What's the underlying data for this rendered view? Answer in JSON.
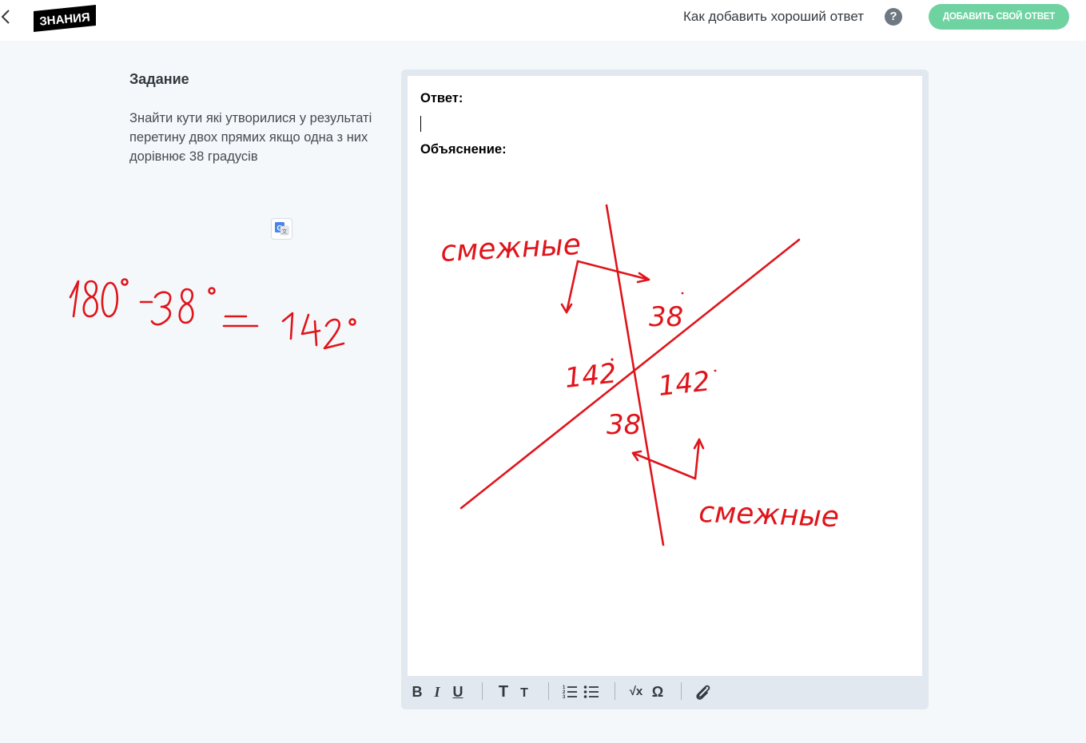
{
  "header": {
    "logo_text": "ЗНАНИЯ",
    "help_label": "Как добавить хороший ответ",
    "help_icon_glyph": "?",
    "add_answer_label": "ДОБАВИТЬ СВОЙ ОТВЕТ",
    "accent_color": "#6fd3a1"
  },
  "task": {
    "title": "Задание",
    "text": "Знайти кути які утворилися у результаті перетину двох прямих якщо одна з них дорівнює 38 градусів"
  },
  "editor": {
    "answer_label": "Ответ:",
    "answer_value": "",
    "explanation_label": "Объяснение:"
  },
  "sketch": {
    "left_formula": "180° − 38° = 142°",
    "labels": {
      "top_note": "смежные",
      "bottom_note": "смежные",
      "angle_top": "38",
      "angle_bottom": "38",
      "angle_left": "142",
      "angle_right": "142"
    },
    "ink_color": "#e0141b"
  },
  "toolbar": {
    "bold": "B",
    "italic": "I",
    "underline": "U",
    "text_large": "T",
    "text_small": "T",
    "formula": "√x",
    "symbol": "Ω"
  }
}
